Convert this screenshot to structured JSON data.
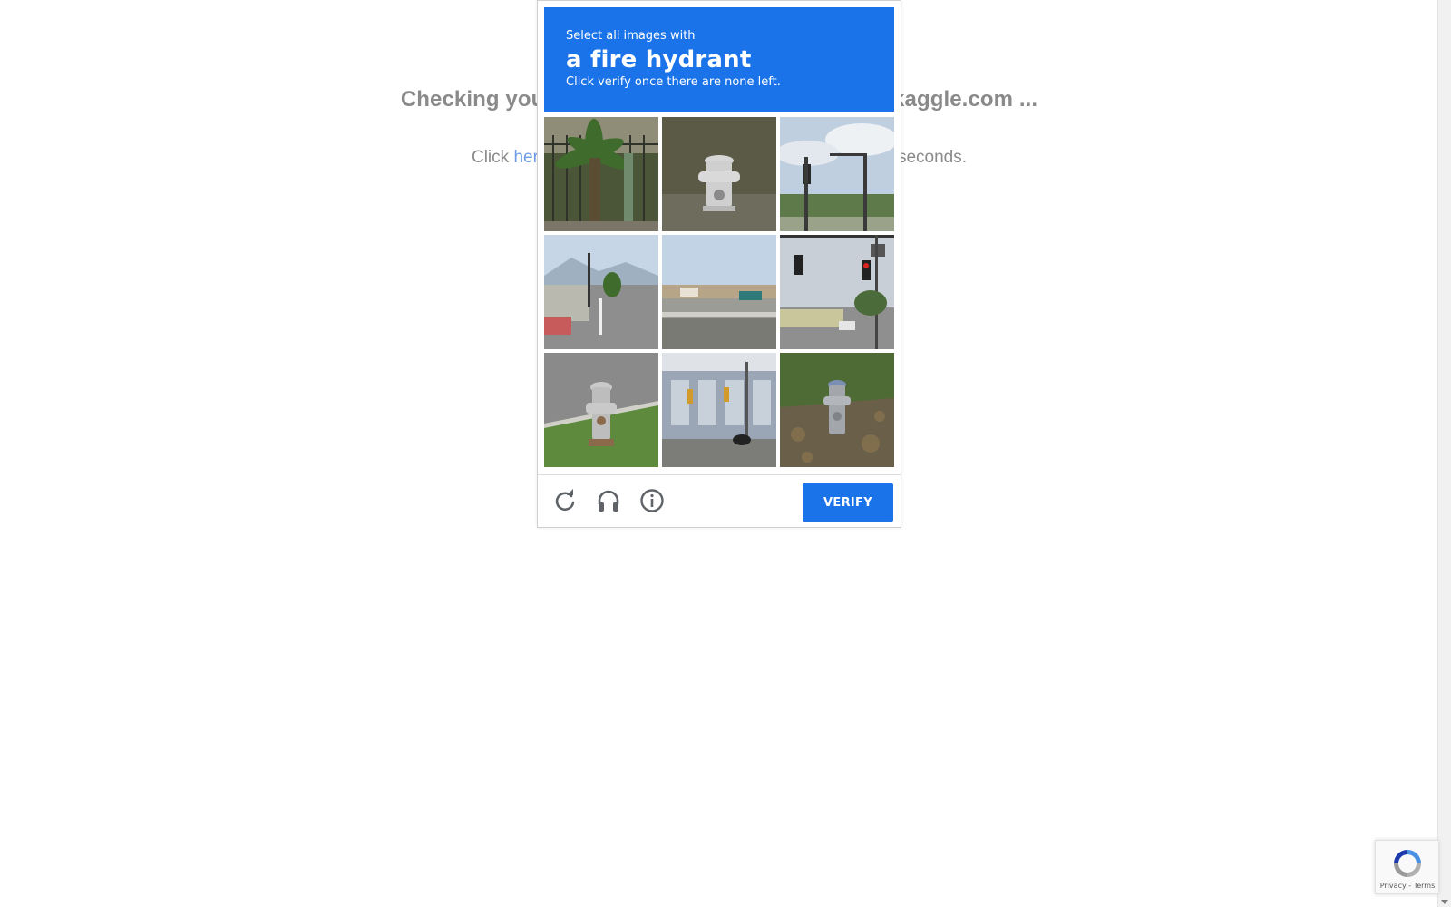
{
  "background": {
    "heading": "Checking your browser before accessing www.kaggle.com ...",
    "sub_prefix": "Click ",
    "sub_link": "here",
    "sub_suffix": " if you are not automatically redirected after 5 seconds."
  },
  "captcha": {
    "instruction_top": "Select all images with",
    "target": "a fire hydrant",
    "instruction_bottom": "Click verify once there are none left.",
    "verify_label": "VERIFY",
    "tiles": [
      {
        "content": "palm tree and fence"
      },
      {
        "content": "fire hydrant"
      },
      {
        "content": "traffic lights and sky"
      },
      {
        "content": "street corner with traffic light"
      },
      {
        "content": "highway overpass"
      },
      {
        "content": "traffic lights over road"
      },
      {
        "content": "fire hydrant on grass"
      },
      {
        "content": "building with traffic lights"
      },
      {
        "content": "fire hydrant on grass"
      }
    ],
    "footer_icons": [
      "reload-icon",
      "audio-headphones-icon",
      "info-icon"
    ],
    "colors": {
      "header": "#1a73e8",
      "button": "#1a73e8"
    }
  },
  "badge": {
    "privacy": "Privacy",
    "separator": " - ",
    "terms": "Terms"
  }
}
